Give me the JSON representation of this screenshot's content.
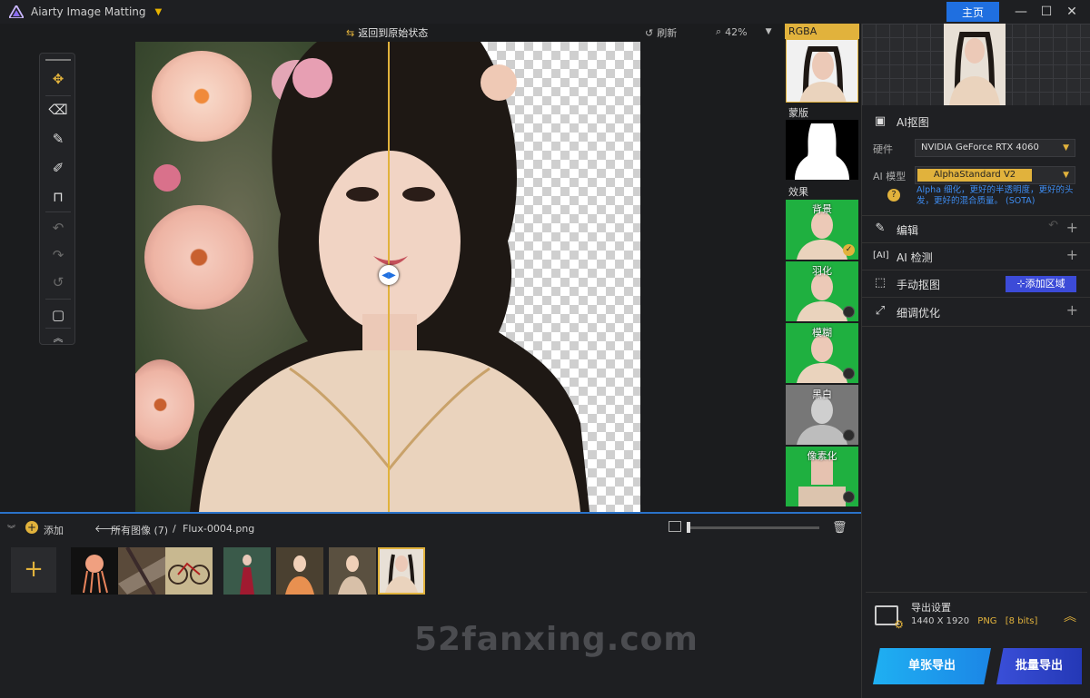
{
  "titlebar": {
    "app_title": "Aiarty Image Matting",
    "home_label": "主页",
    "min": "—",
    "max": "☐",
    "close": "✕"
  },
  "toolbar": {
    "revert_label": "返回到原始状态",
    "refresh_label": "刷新",
    "zoom": "42%"
  },
  "thumbs": {
    "rgba": "RGBA",
    "mask": "蒙版",
    "effects": "效果",
    "items": [
      {
        "label": "背景"
      },
      {
        "label": "羽化"
      },
      {
        "label": "模糊"
      },
      {
        "label": "黑白"
      },
      {
        "label": "像素化"
      }
    ]
  },
  "right": {
    "ai_matting": "AI抠图",
    "hardware_label": "硬件",
    "hardware_value": "NVIDIA GeForce RTX 4060",
    "model_label": "AI 模型",
    "model_value": "AlphaStandard  V2",
    "hint": "Alpha 细化，更好的半透明度，更好的头发，更好的混合质量。 (SOTA)",
    "edit": "编辑",
    "ai_detect": "AI 检测",
    "manual": "手动抠图",
    "add_area": "添加区域",
    "refine": "细调优化",
    "export_settings": "导出设置",
    "export_size": "1440 X 1920",
    "export_format": "PNG",
    "export_bits": "[8 bits]",
    "single_export": "单张导出",
    "batch_export": "批量导出"
  },
  "bottom": {
    "add_label": "添加",
    "breadcrumb_all": "所有图像 (7)",
    "breadcrumb_sep": "/",
    "filename": "Flux-0004.png",
    "watermark": "52fanxing.com"
  },
  "colors": {
    "accent": "#e1b23c",
    "blue": "#1f6fe0",
    "bg": "#1b1c1e"
  }
}
